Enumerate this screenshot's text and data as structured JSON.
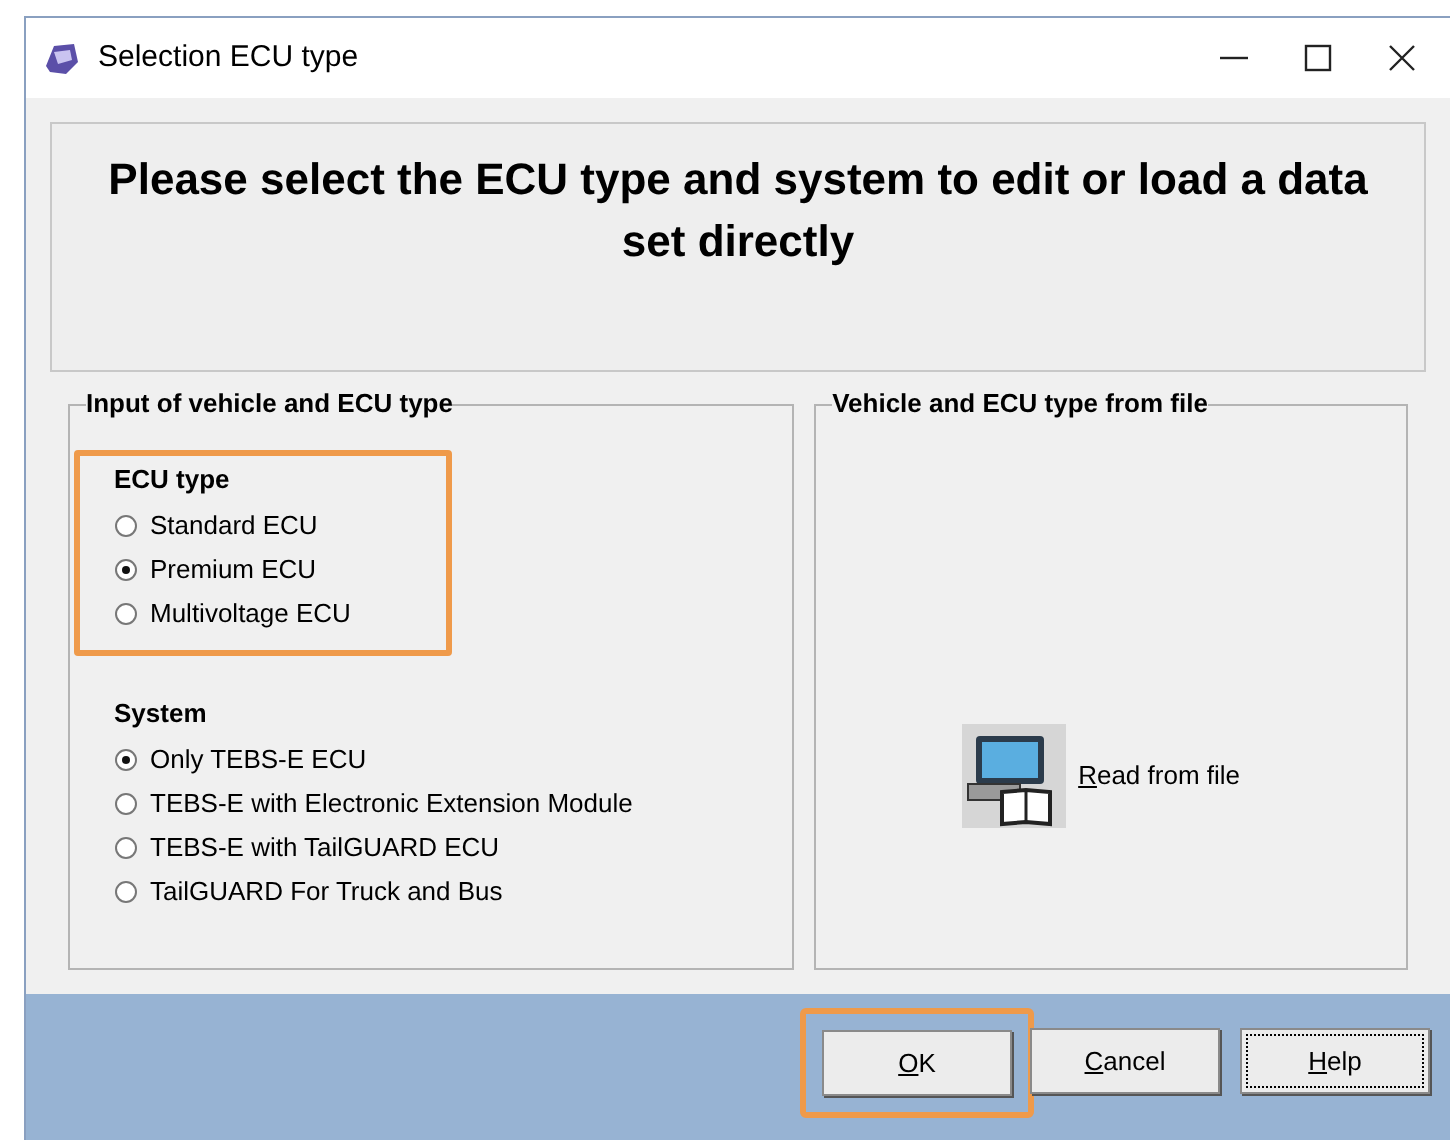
{
  "window": {
    "title": "Selection ECU type"
  },
  "heading": "Please select the ECU type and system to edit or load a data set directly",
  "input_group": {
    "title": "Input of vehicle and ECU type",
    "ecu_type": {
      "label": "ECU type",
      "highlighted": true,
      "options": [
        {
          "label": "Standard ECU",
          "selected": false
        },
        {
          "label": "Premium ECU",
          "selected": true
        },
        {
          "label": "Multivoltage ECU",
          "selected": false
        }
      ]
    },
    "system": {
      "label": "System",
      "highlighted": false,
      "options": [
        {
          "label": "Only TEBS-E ECU",
          "selected": true
        },
        {
          "label": "TEBS-E with Electronic Extension Module",
          "selected": false
        },
        {
          "label": "TEBS-E with TailGUARD ECU",
          "selected": false
        },
        {
          "label": "TailGUARD For Truck and Bus",
          "selected": false
        }
      ]
    }
  },
  "file_group": {
    "title": "Vehicle and ECU type from file",
    "read_button": {
      "label": "Read from file",
      "access_key_underlined": true
    }
  },
  "buttons": [
    {
      "label": "OK",
      "highlighted": true,
      "focused": false,
      "access_key_underlined": true
    },
    {
      "label": "Cancel",
      "highlighted": false,
      "focused": false,
      "access_key_underlined": true
    },
    {
      "label": "Help",
      "highlighted": false,
      "focused": true,
      "access_key_underlined": true
    }
  ]
}
